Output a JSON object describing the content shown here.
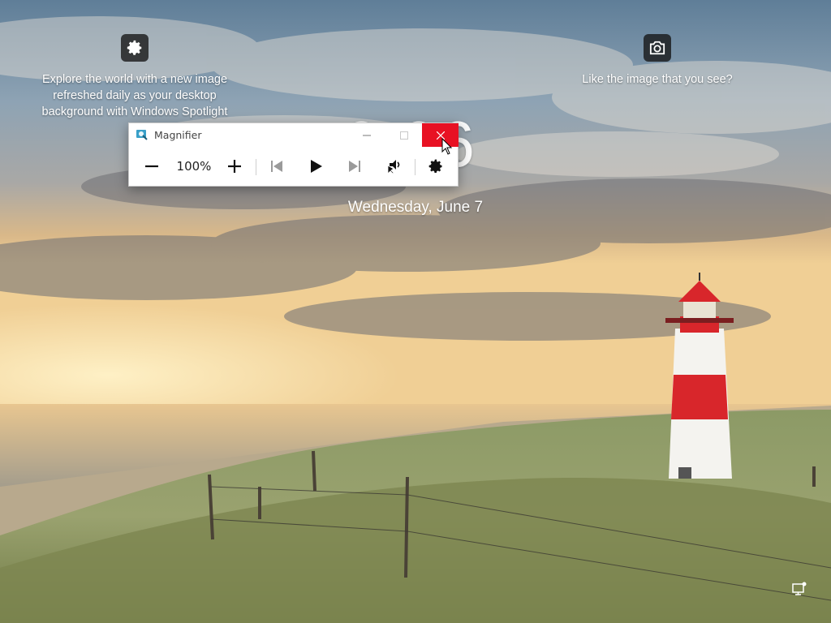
{
  "spotlight": {
    "left_text": "Explore the world with a new image\nrefreshed daily as your desktop\nbackground with Windows Spotlight",
    "left_icon": "gear-icon",
    "right_text": "Like the image that you see?",
    "right_icon": "camera-icon"
  },
  "lockscreen": {
    "time": "0:06",
    "date": "Wednesday, June 7"
  },
  "magnifier": {
    "title": "Magnifier",
    "zoom": "100%",
    "buttons": {
      "zoom_out": "minus-icon",
      "zoom_in": "plus-icon",
      "previous": "skip-back-icon",
      "play": "play-icon",
      "next": "skip-forward-icon",
      "read_from_here": "read-from-here-icon",
      "settings": "gear-icon"
    },
    "window_controls": [
      "minimize-icon",
      "maximize-icon",
      "close-icon"
    ]
  },
  "colors": {
    "close_button": "#e81123",
    "window_bg": "#ffffff",
    "text": "#222222",
    "lighthouse_red": "#d8262b"
  }
}
